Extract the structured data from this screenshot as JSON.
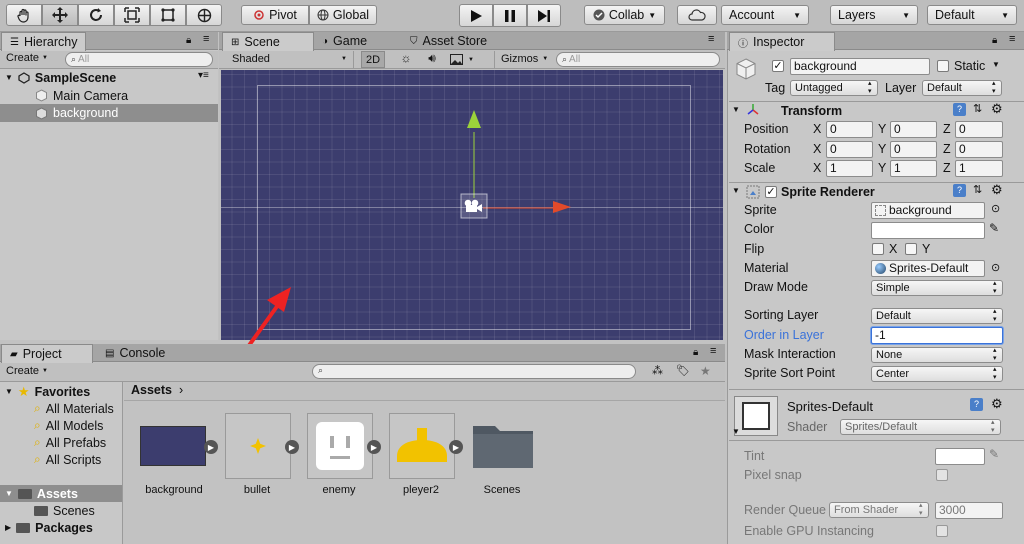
{
  "toolbar": {
    "pivot_label": "Pivot",
    "global_label": "Global",
    "collab_label": "Collab",
    "account_label": "Account",
    "layers_label": "Layers",
    "layout_label": "Default"
  },
  "hierarchy": {
    "tab_label": "Hierarchy",
    "create_label": "Create",
    "search_placeholder": "All",
    "scene_name": "SampleScene",
    "items": [
      {
        "label": "Main Camera"
      },
      {
        "label": "background"
      }
    ]
  },
  "scene_view": {
    "tabs": [
      {
        "label": "Scene"
      },
      {
        "label": "Game"
      },
      {
        "label": "Asset Store"
      }
    ],
    "shading_mode": "Shaded",
    "mode_2d": "2D",
    "gizmos_label": "Gizmos",
    "search_placeholder": "All",
    "background_color": "#3c3d6e"
  },
  "project": {
    "tabs": [
      {
        "label": "Project"
      },
      {
        "label": "Console"
      }
    ],
    "create_label": "Create",
    "favorites_label": "Favorites",
    "favorites": [
      {
        "label": "All Materials"
      },
      {
        "label": "All Models"
      },
      {
        "label": "All Prefabs"
      },
      {
        "label": "All Scripts"
      }
    ],
    "assets_label": "Assets",
    "assets_children": [
      {
        "label": "Scenes"
      }
    ],
    "packages_label": "Packages",
    "breadcrumb": "Assets",
    "asset_items": [
      {
        "label": "background"
      },
      {
        "label": "bullet"
      },
      {
        "label": "enemy"
      },
      {
        "label": "pleyer2"
      },
      {
        "label": "Scenes"
      }
    ]
  },
  "inspector": {
    "tab_label": "Inspector",
    "object_name": "background",
    "static_label": "Static",
    "tag_label": "Tag",
    "tag_value": "Untagged",
    "layer_label": "Layer",
    "layer_value": "Default",
    "transform": {
      "title": "Transform",
      "rows": [
        {
          "label": "Position",
          "x": "0",
          "y": "0",
          "z": "0"
        },
        {
          "label": "Rotation",
          "x": "0",
          "y": "0",
          "z": "0"
        },
        {
          "label": "Scale",
          "x": "1",
          "y": "1",
          "z": "1"
        }
      ],
      "axis_x": "X",
      "axis_y": "Y",
      "axis_z": "Z"
    },
    "sprite_renderer": {
      "title": "Sprite Renderer",
      "sprite_label": "Sprite",
      "sprite_value": "background",
      "color_label": "Color",
      "flip_label": "Flip",
      "flip_x": "X",
      "flip_y": "Y",
      "material_label": "Material",
      "material_value": "Sprites-Default",
      "draw_mode_label": "Draw Mode",
      "draw_mode_value": "Simple",
      "sorting_layer_label": "Sorting Layer",
      "sorting_layer_value": "Default",
      "order_label": "Order in Layer",
      "order_value": "-1",
      "mask_label": "Mask Interaction",
      "mask_value": "None",
      "sort_point_label": "Sprite Sort Point",
      "sort_point_value": "Center"
    },
    "material": {
      "title": "Sprites-Default",
      "shader_label": "Shader",
      "shader_value": "Sprites/Default",
      "tint_label": "Tint",
      "pixel_snap_label": "Pixel snap",
      "render_queue_label": "Render Queue",
      "render_queue_mode": "From Shader",
      "render_queue_value": "3000",
      "gpu_instancing_label": "Enable GPU Instancing"
    }
  },
  "colors": {
    "accent_blue": "#3a72d9",
    "annotation_red": "#ee2222",
    "gizmo_green": "#9bd23a",
    "gizmo_red": "#e24a2a"
  }
}
